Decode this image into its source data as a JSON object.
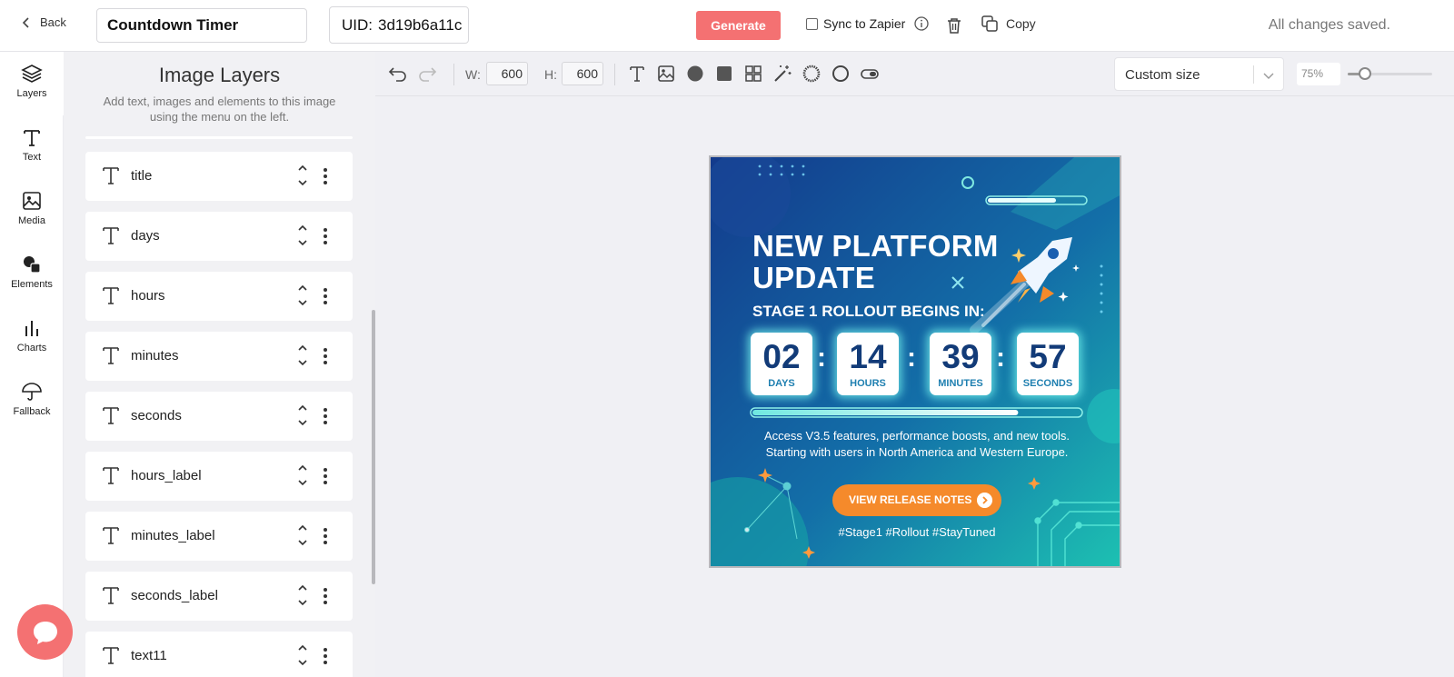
{
  "header": {
    "back_label": "Back",
    "timer_name": "Countdown Timer",
    "uid_label": "UID:",
    "uid_value": "3d19b6a11c",
    "generate_label": "Generate",
    "sync_label": "Sync to Zapier",
    "copy_label": "Copy",
    "saved_status": "All changes saved.",
    "accent_color": "#f47172"
  },
  "rail": {
    "items": [
      {
        "label": "Layers",
        "icon": "layers-icon",
        "active": true
      },
      {
        "label": "Text",
        "icon": "text-icon"
      },
      {
        "label": "Media",
        "icon": "image-icon"
      },
      {
        "label": "Elements",
        "icon": "shapes-icon"
      },
      {
        "label": "Charts",
        "icon": "bar-chart-icon"
      },
      {
        "label": "Fallback",
        "icon": "umbrella-icon"
      }
    ]
  },
  "layers_panel": {
    "title": "Image Layers",
    "subtitle": "Add text, images and elements to this image using the menu on the left.",
    "layers": [
      {
        "name": "title"
      },
      {
        "name": "days"
      },
      {
        "name": "hours"
      },
      {
        "name": "minutes"
      },
      {
        "name": "seconds"
      },
      {
        "name": "hours_label"
      },
      {
        "name": "minutes_label"
      },
      {
        "name": "seconds_label"
      },
      {
        "name": "text11"
      }
    ]
  },
  "toolbar": {
    "width_label": "W:",
    "width_value": "600",
    "height_label": "H:",
    "height_value": "600",
    "icons": [
      "undo-icon",
      "redo-icon",
      "text-icon",
      "image-icon",
      "circle-icon",
      "square-icon",
      "grid-icon",
      "magic-wand-icon",
      "ring-icon",
      "outline-circle-icon",
      "toggle-icon"
    ],
    "size_select_value": "Custom size",
    "zoom_value": "75%",
    "zoom_level": 0.2
  },
  "artwork": {
    "title_line1": "NEW PLATFORM",
    "title_line2": "UPDATE",
    "subtitle": "STAGE 1 ROLLOUT BEGINS IN:",
    "timer": {
      "days": "02",
      "days_label": "DAYS",
      "hours": "14",
      "hours_label": "HOURS",
      "minutes": "39",
      "minutes_label": "MINUTES",
      "seconds": "57",
      "seconds_label": "SECONDS"
    },
    "progress": 0.81,
    "description_line1": "Access V3.5 features, performance boosts, and new tools.",
    "description_line2": "Starting with users in North America and Western Europe.",
    "cta_label": "VIEW RELEASE NOTES",
    "hashtags": "#Stage1 #Rollout #StayTuned",
    "colors": {
      "bg_start": "#123a8a",
      "bg_end": "#1ec3b5",
      "cta": "#f58a2b",
      "number": "#123b78"
    }
  }
}
